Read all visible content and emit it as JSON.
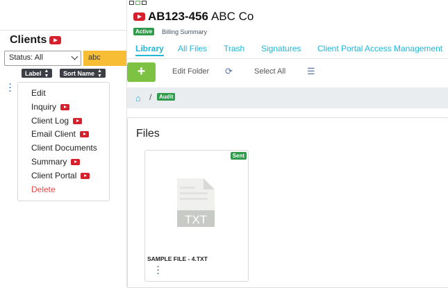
{
  "clients": {
    "title": "Clients",
    "status_filter": "Status: All",
    "search_value": "abc",
    "sort": [
      {
        "label": "Label"
      },
      {
        "label": "Sort Name"
      }
    ],
    "context_menu": [
      {
        "label": "Edit",
        "video": false,
        "danger": false
      },
      {
        "label": "Inquiry",
        "video": true,
        "danger": false
      },
      {
        "label": "Client Log",
        "video": true,
        "danger": false
      },
      {
        "label": "Email Client",
        "video": true,
        "danger": false
      },
      {
        "label": "Client Documents",
        "video": false,
        "danger": false
      },
      {
        "label": "Summary",
        "video": true,
        "danger": false
      },
      {
        "label": "Client Portal",
        "video": true,
        "danger": false
      },
      {
        "label": "Delete",
        "video": false,
        "danger": true
      }
    ]
  },
  "client": {
    "code": "AB123-456",
    "name": "ABC Co",
    "status_badge": "Active",
    "billing_link": "Billing Summary"
  },
  "tabs": [
    {
      "label": "Library",
      "active": true
    },
    {
      "label": "All Files",
      "active": false
    },
    {
      "label": "Trash",
      "active": false
    },
    {
      "label": "Signatures",
      "active": false
    },
    {
      "label": "Client Portal Access Management",
      "active": false
    }
  ],
  "toolbar": {
    "add_label": "+",
    "edit_folder_label": "Edit Folder",
    "refresh_icon": "refresh-icon",
    "select_all_label": "Select All",
    "list_view_icon": "list-icon"
  },
  "breadcrumb": {
    "home_icon": "home-icon",
    "separator": "/",
    "folder": "Audit"
  },
  "files": {
    "heading": "Files",
    "items": [
      {
        "name": "SAMPLE FILE - 4.TXT",
        "ext": "TXT",
        "badge": "Sent"
      }
    ]
  },
  "colors": {
    "accent": "#1fb6d8",
    "success": "#2e9a4a",
    "add_button": "#7dc243",
    "search_highlight": "#f7bd35",
    "danger": "#e84a4a"
  }
}
